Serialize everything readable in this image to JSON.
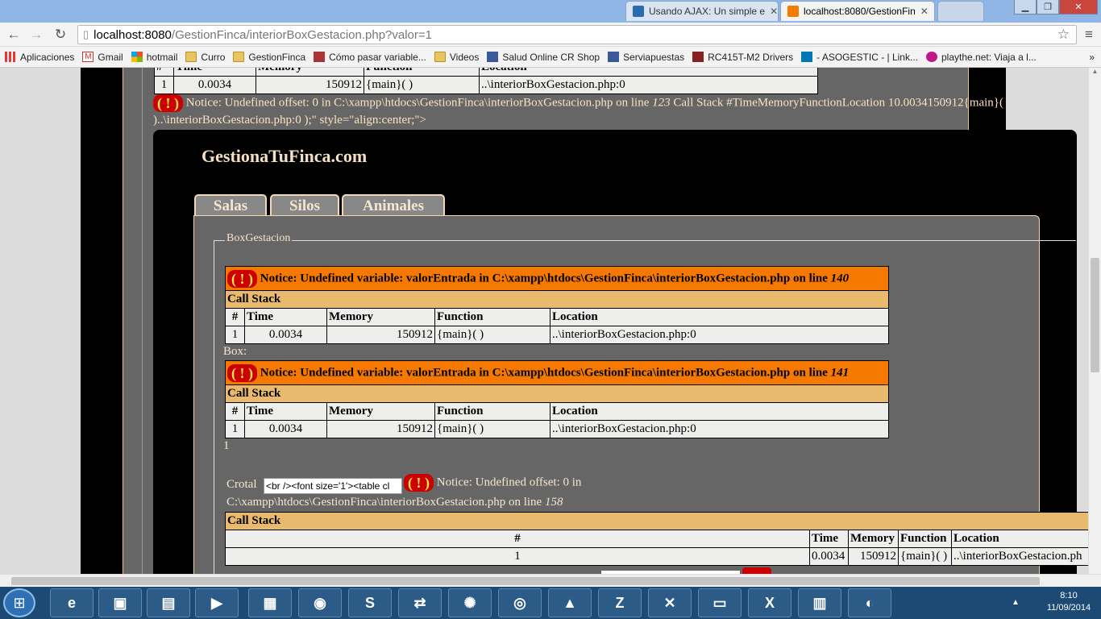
{
  "browser": {
    "tabs": [
      {
        "title": "Usando AJAX: Un simple e",
        "active": false
      },
      {
        "title": "localhost:8080/GestionFin",
        "active": true
      }
    ],
    "url_host": "localhost:8080",
    "url_path": "/GestionFinca/interiorBoxGestacion.php?valor=1",
    "bookmarks": [
      {
        "label": "Aplicaciones",
        "icon": "apps-grid-icon"
      },
      {
        "label": "Gmail",
        "icon": "gmail-icon"
      },
      {
        "label": "hotmail",
        "icon": "windows-icon"
      },
      {
        "label": "Curro",
        "icon": "folder-icon"
      },
      {
        "label": "GestionFinca",
        "icon": "folder-icon"
      },
      {
        "label": "Cómo pasar variable...",
        "icon": "bookmark-icon"
      },
      {
        "label": "Videos",
        "icon": "folder-icon"
      },
      {
        "label": "Salud Online CR Shop",
        "icon": "facebook-icon"
      },
      {
        "label": "Serviapuestas",
        "icon": "facebook-icon"
      },
      {
        "label": "RC415T-M2 Drivers",
        "icon": "bookmark-icon"
      },
      {
        "label": "- ASOGESTIC - | Link...",
        "icon": "linkedin-icon"
      },
      {
        "label": "playthe.net: Viaja a l...",
        "icon": "playthe-icon"
      }
    ],
    "more_bookmarks": "»"
  },
  "top_table": {
    "cut_headers": [
      "#",
      "Time",
      "Memory",
      "Function",
      "Location"
    ],
    "row": [
      "1",
      "0.0034",
      "150912",
      "{main}( )",
      "..\\interiorBoxGestacion.php:0"
    ]
  },
  "top_notice": {
    "bang": "( ! )",
    "line1": " Notice: Undefined offset: 0 in C:\\xampp\\htdocs\\GestionFinca\\interiorBoxGestacion.php on line ",
    "line_no": "123",
    "line1b": " Call Stack #TimeMemoryFunctionLocation 10.0034150912{main}(",
    "line2": ")..\\interiorBoxGestacion.php:0 );\" style=\"align:center;\">"
  },
  "site": {
    "title": "GestionaTuFinca.com",
    "tabs": [
      "Salas",
      "Silos",
      "Animales"
    ],
    "legend": "BoxGestacion"
  },
  "errors": [
    {
      "bang": "( ! )",
      "message": "Notice: Undefined variable: valorEntrada in C:\\xampp\\htdocs\\GestionFinca\\interiorBoxGestacion.php on line ",
      "line_no": "140",
      "call_stack": "Call Stack",
      "headers": [
        "#",
        "Time",
        "Memory",
        "Function",
        "Location"
      ],
      "row": [
        "1",
        "0.0034",
        "150912",
        "{main}( )",
        "..\\interiorBoxGestacion.php:0"
      ]
    },
    {
      "bang": "( ! )",
      "message": "Notice: Undefined variable: valorEntrada in C:\\xampp\\htdocs\\GestionFinca\\interiorBoxGestacion.php on line ",
      "line_no": "141",
      "call_stack": "Call Stack",
      "headers": [
        "#",
        "Time",
        "Memory",
        "Function",
        "Location"
      ],
      "row": [
        "1",
        "0.0034",
        "150912",
        "{main}( )",
        "..\\interiorBoxGestacion.php:0"
      ]
    }
  ],
  "box_label": "Box:",
  "value_one": "1",
  "crotal": {
    "label": "Crotal",
    "input_value": "<br /><font size='1'><table cl",
    "bang": "( ! )",
    "notice": " Notice: Undefined offset: 0 in",
    "path_line": "C:\\xampp\\htdocs\\GestionFinca\\interiorBoxGestacion.php on line ",
    "line_no": "158",
    "call_stack": "Call Stack",
    "headers": [
      "#",
      "Time",
      "Memory",
      "Function",
      "Location"
    ],
    "row": [
      "1",
      "0.0034",
      "150912",
      "{main}( )",
      "..\\interiorBoxGestacion.ph"
    ]
  },
  "taskbar": {
    "apps": [
      "internet-explorer-icon",
      "installer-icon",
      "file-explorer-icon",
      "media-player-icon",
      "notepad-icon",
      "firefox-icon",
      "php-icon",
      "teamviewer-icon",
      "network-icon",
      "chrome-icon",
      "vlc-icon",
      "filezilla-icon",
      "xampp-icon",
      "terminal-icon",
      "excel-icon",
      "paint-icon",
      "palette-icon"
    ],
    "time": "8:10",
    "date": "11/09/2014"
  }
}
